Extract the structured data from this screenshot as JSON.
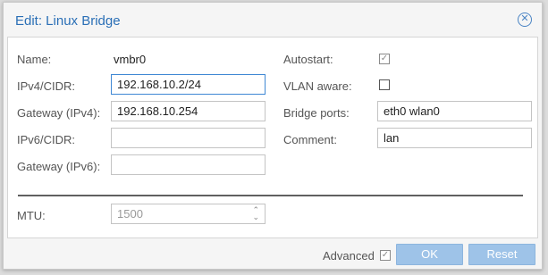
{
  "dialog": {
    "title": "Edit: Linux Bridge"
  },
  "left": {
    "name_label": "Name:",
    "name_value": "vmbr0",
    "ipv4_label": "IPv4/CIDR:",
    "ipv4_value": "192.168.10.2/24",
    "gw4_label": "Gateway (IPv4):",
    "gw4_value": "192.168.10.254",
    "ipv6_label": "IPv6/CIDR:",
    "ipv6_value": "",
    "gw6_label": "Gateway (IPv6):",
    "gw6_value": ""
  },
  "right": {
    "autostart_label": "Autostart:",
    "autostart_checked": true,
    "vlan_label": "VLAN aware:",
    "vlan_checked": false,
    "ports_label": "Bridge ports:",
    "ports_value": "eth0 wlan0",
    "comment_label": "Comment:",
    "comment_value": "lan"
  },
  "advanced": {
    "mtu_label": "MTU:",
    "mtu_value": "1500"
  },
  "footer": {
    "advanced_label": "Advanced",
    "advanced_checked": true,
    "ok_label": "OK",
    "reset_label": "Reset"
  },
  "icons": {
    "close": "close-icon",
    "check": "checkmark-icon",
    "spinner": "spinner-arrows-icon"
  },
  "colors": {
    "title": "#2a6fb6",
    "button_disabled": "#9ec3e8",
    "focus_border": "#3f88d4"
  }
}
